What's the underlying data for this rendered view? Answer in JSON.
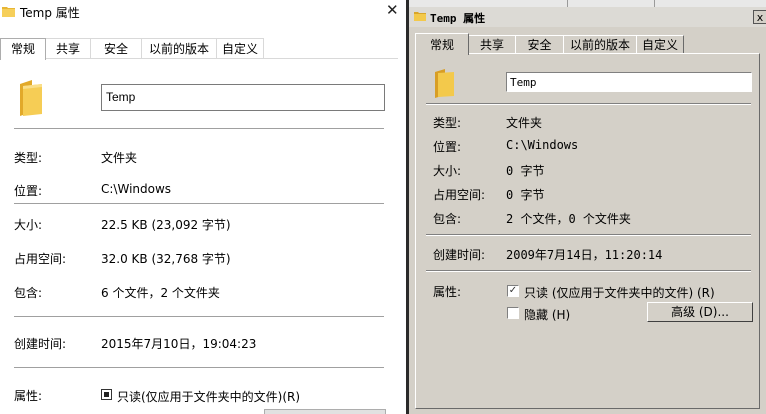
{
  "left_window": {
    "title": "Temp 属性",
    "close_glyph": "✕",
    "tabs": [
      "常规",
      "共享",
      "安全",
      "以前的版本",
      "自定义"
    ],
    "name_value": "Temp",
    "rows": [
      {
        "label": "类型:",
        "value": "文件夹"
      },
      {
        "label": "位置:",
        "value": "C:\\Windows"
      },
      {
        "label": "大小:",
        "value": "22.5 KB (23,092 字节)"
      },
      {
        "label": "占用空间:",
        "value": "32.0 KB (32,768 字节)"
      },
      {
        "label": "包含:",
        "value": "6 个文件，2 个文件夹"
      }
    ],
    "created_label": "创建时间:",
    "created_value": "2015年7月10日，19:04:23",
    "attributes_label": "属性:",
    "readonly_label": "只读(仅应用于文件夹中的文件)(R)"
  },
  "right_window": {
    "title": "Temp 属性",
    "close_glyph": "x",
    "tabs": [
      "常规",
      "共享",
      "安全",
      "以前的版本",
      "自定义"
    ],
    "name_value": "Temp",
    "rows": [
      {
        "label": "类型:",
        "value": "文件夹"
      },
      {
        "label": "位置:",
        "value": "C:\\Windows"
      },
      {
        "label": "大小:",
        "value": "0 字节"
      },
      {
        "label": "占用空间:",
        "value": "0 字节"
      },
      {
        "label": "包含:",
        "value": "2 个文件，0 个文件夹"
      }
    ],
    "created_label": "创建时间:",
    "created_value": "2009年7月14日，11:20:14",
    "attributes_label": "属性:",
    "readonly_label": "只读 (仅应用于文件夹中的文件) (R)",
    "readonly_check_glyph": "✓",
    "hidden_label": "隐藏 (H)",
    "advanced_button": "高级 (D)..."
  },
  "colors": {
    "left_bg": "#ffffff",
    "right_bg": "#d4d0c8",
    "folder_yellow": "#f3c94b"
  }
}
